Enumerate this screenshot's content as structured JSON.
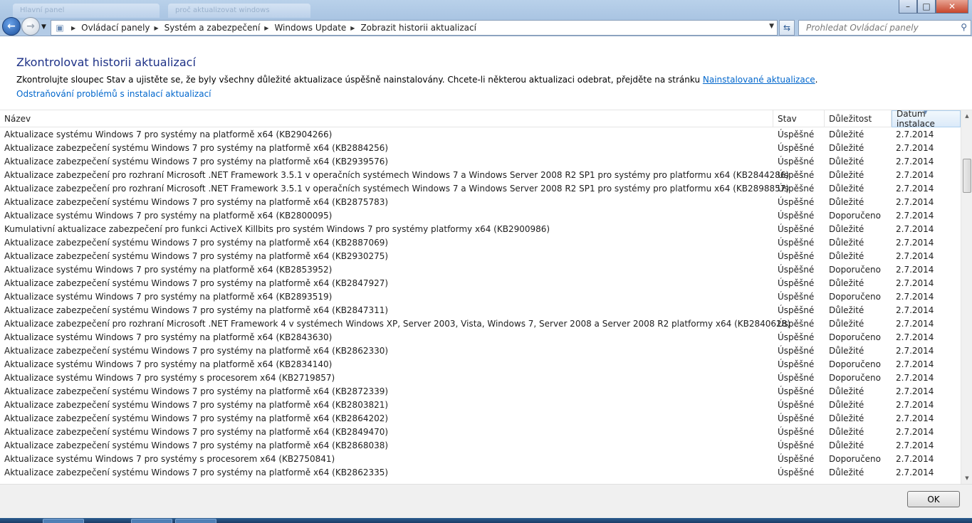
{
  "window": {
    "tab1": "Hlavní panel",
    "tab2": "proč aktualizovat windows",
    "minimize": "–",
    "maximize": "□",
    "close": "✕"
  },
  "address_bar": {
    "crumbs": [
      "Ovládací panely",
      "Systém a zabezpečení",
      "Windows Update",
      "Zobrazit historii aktualizací"
    ],
    "search_placeholder": "Prohledat Ovládací panely"
  },
  "page": {
    "title": "Zkontrolovat historii aktualizací",
    "desc_text": "Zkontrolujte sloupec Stav a ujistěte se, že byly všechny důležité aktualizace úspěšně nainstalovány. Chcete-li některou aktualizaci odebrat, přejděte na stránku ",
    "desc_link": "Nainstalované aktualizace",
    "desc_end": ".",
    "troubleshoot_link": "Odstraňování problémů s instalací aktualizací"
  },
  "columns": {
    "name": "Název",
    "status": "Stav",
    "importance": "Důležitost",
    "date": "Datum instalace"
  },
  "rows": [
    {
      "name": "Aktualizace systému Windows 7 pro systémy na platformě x64 (KB2904266)",
      "status": "Úspěšné",
      "importance": "Důležité",
      "date": "2.7.2014"
    },
    {
      "name": "Aktualizace zabezpečení systému Windows 7 pro systémy na platformě x64 (KB2884256)",
      "status": "Úspěšné",
      "importance": "Důležité",
      "date": "2.7.2014"
    },
    {
      "name": "Aktualizace zabezpečení systému Windows 7 pro systémy na platformě x64 (KB2939576)",
      "status": "Úspěšné",
      "importance": "Důležité",
      "date": "2.7.2014"
    },
    {
      "name": "Aktualizace zabezpečení pro rozhraní Microsoft .NET Framework 3.5.1 v operačních systémech Windows 7 a Windows Server 2008 R2 SP1 pro systémy pro platformu x64 (KB2844286)",
      "status": "Úspěšné",
      "importance": "Důležité",
      "date": "2.7.2014"
    },
    {
      "name": "Aktualizace zabezpečení pro rozhraní Microsoft .NET Framework 3.5.1 v operačních systémech Windows 7 a Windows Server 2008 R2 SP1 pro systémy pro platformu x64 (KB2898857)",
      "status": "Úspěšné",
      "importance": "Důležité",
      "date": "2.7.2014"
    },
    {
      "name": "Aktualizace zabezpečení systému Windows 7 pro systémy na platformě x64 (KB2875783)",
      "status": "Úspěšné",
      "importance": "Důležité",
      "date": "2.7.2014"
    },
    {
      "name": "Aktualizace systému Windows 7 pro systémy na platformě x64 (KB2800095)",
      "status": "Úspěšné",
      "importance": "Doporučeno",
      "date": "2.7.2014"
    },
    {
      "name": "Kumulativní aktualizace zabezpečení pro funkci ActiveX Killbits pro systém Windows 7 pro systémy platformy x64 (KB2900986)",
      "status": "Úspěšné",
      "importance": "Důležité",
      "date": "2.7.2014"
    },
    {
      "name": "Aktualizace zabezpečení systému Windows 7 pro systémy na platformě x64 (KB2887069)",
      "status": "Úspěšné",
      "importance": "Důležité",
      "date": "2.7.2014"
    },
    {
      "name": "Aktualizace zabezpečení systému Windows 7 pro systémy na platformě x64 (KB2930275)",
      "status": "Úspěšné",
      "importance": "Důležité",
      "date": "2.7.2014"
    },
    {
      "name": "Aktualizace systému Windows 7 pro systémy na platformě x64 (KB2853952)",
      "status": "Úspěšné",
      "importance": "Doporučeno",
      "date": "2.7.2014"
    },
    {
      "name": "Aktualizace zabezpečení systému Windows 7 pro systémy na platformě x64 (KB2847927)",
      "status": "Úspěšné",
      "importance": "Důležité",
      "date": "2.7.2014"
    },
    {
      "name": "Aktualizace systému Windows 7 pro systémy na platformě x64 (KB2893519)",
      "status": "Úspěšné",
      "importance": "Doporučeno",
      "date": "2.7.2014"
    },
    {
      "name": "Aktualizace zabezpečení systému Windows 7 pro systémy na platformě x64 (KB2847311)",
      "status": "Úspěšné",
      "importance": "Důležité",
      "date": "2.7.2014"
    },
    {
      "name": "Aktualizace zabezpečení pro rozhraní Microsoft .NET Framework 4 v systémech Windows XP, Server 2003, Vista, Windows 7, Server 2008 a Server 2008 R2 platformy x64 (KB2840628)",
      "status": "Úspěšné",
      "importance": "Důležité",
      "date": "2.7.2014"
    },
    {
      "name": "Aktualizace systému Windows 7 pro systémy na platformě x64 (KB2843630)",
      "status": "Úspěšné",
      "importance": "Doporučeno",
      "date": "2.7.2014"
    },
    {
      "name": "Aktualizace zabezpečení systému Windows 7 pro systémy na platformě x64 (KB2862330)",
      "status": "Úspěšné",
      "importance": "Důležité",
      "date": "2.7.2014"
    },
    {
      "name": "Aktualizace systému Windows 7 pro systémy na platformě x64 (KB2834140)",
      "status": "Úspěšné",
      "importance": "Doporučeno",
      "date": "2.7.2014"
    },
    {
      "name": "Aktualizace systému Windows 7 pro systémy s procesorem x64 (KB2719857)",
      "status": "Úspěšné",
      "importance": "Doporučeno",
      "date": "2.7.2014"
    },
    {
      "name": "Aktualizace zabezpečení systému Windows 7 pro systémy na platformě x64 (KB2872339)",
      "status": "Úspěšné",
      "importance": "Důležité",
      "date": "2.7.2014"
    },
    {
      "name": "Aktualizace zabezpečení systému Windows 7 pro systémy na platformě x64 (KB2803821)",
      "status": "Úspěšné",
      "importance": "Důležité",
      "date": "2.7.2014"
    },
    {
      "name": "Aktualizace zabezpečení systému Windows 7 pro systémy na platformě x64 (KB2864202)",
      "status": "Úspěšné",
      "importance": "Důležité",
      "date": "2.7.2014"
    },
    {
      "name": "Aktualizace zabezpečení systému Windows 7 pro systémy na platformě x64 (KB2849470)",
      "status": "Úspěšné",
      "importance": "Důležité",
      "date": "2.7.2014"
    },
    {
      "name": "Aktualizace zabezpečení systému Windows 7 pro systémy na platformě x64 (KB2868038)",
      "status": "Úspěšné",
      "importance": "Důležité",
      "date": "2.7.2014"
    },
    {
      "name": "Aktualizace systému Windows 7 pro systémy s procesorem x64 (KB2750841)",
      "status": "Úspěšné",
      "importance": "Doporučeno",
      "date": "2.7.2014"
    },
    {
      "name": "Aktualizace zabezpečení systému Windows 7 pro systémy na platformě x64 (KB2862335)",
      "status": "Úspěšné",
      "importance": "Důležité",
      "date": "2.7.2014"
    }
  ],
  "footer": {
    "ok": "OK"
  },
  "icons": {
    "back": "back-arrow-icon",
    "forward": "forward-arrow-icon",
    "refresh": "refresh-icon",
    "search": "search-icon",
    "control_panel": "control-panel-icon"
  },
  "colors": {
    "title": "#1e3287",
    "link": "#0066cc",
    "glass": "#b9d1ea"
  }
}
